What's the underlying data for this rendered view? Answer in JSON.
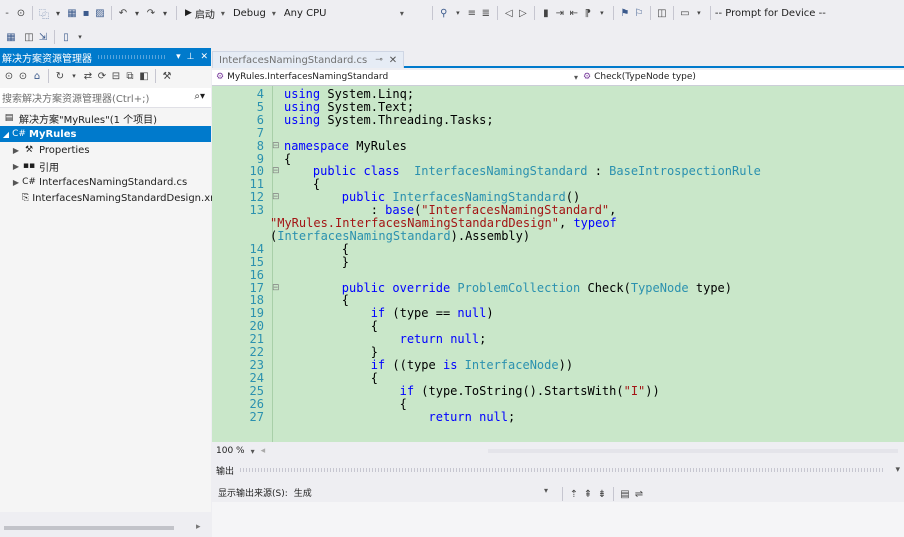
{
  "toolbar": {
    "start_label": "启动",
    "config_label": "Debug",
    "platform_label": "Any CPU",
    "prompt_label": "-- Prompt for Device --",
    "dropdown_glyph": "▾"
  },
  "solution_explorer": {
    "title": "解决方案资源管理器",
    "search_placeholder": "搜索解决方案资源管理器(Ctrl+;)",
    "items": [
      {
        "label": "解决方案\"MyRules\"(1 个项目)",
        "icon": "solution-icon"
      },
      {
        "label": "MyRules",
        "icon": "csharp-project-icon",
        "selected": true
      },
      {
        "label": "Properties",
        "icon": "wrench-icon"
      },
      {
        "label": "引用",
        "icon": "references-icon"
      },
      {
        "label": "InterfacesNamingStandard.cs",
        "icon": "csharp-file-icon"
      },
      {
        "label": "InterfacesNamingStandardDesign.xml",
        "icon": "xml-file-icon"
      }
    ]
  },
  "editor": {
    "tab_title": "InterfacesNamingStandard.cs",
    "nav_left": "MyRules.InterfacesNamingStandard",
    "nav_right": "Check(TypeNode type)",
    "zoom": "100 %"
  },
  "code_lines": [
    {
      "ln": "4",
      "text": "using System.Linq;"
    },
    {
      "ln": "5",
      "text": "using System.Text;"
    },
    {
      "ln": "6",
      "text": "using System.Threading.Tasks;"
    },
    {
      "ln": "7",
      "text": ""
    },
    {
      "ln": "8",
      "text": "namespace MyRules"
    },
    {
      "ln": "9",
      "text": "{"
    },
    {
      "ln": "10",
      "text": "    public class  InterfacesNamingStandard : BaseIntrospectionRule"
    },
    {
      "ln": "11",
      "text": "    {"
    },
    {
      "ln": "12",
      "text": "        public InterfacesNamingStandard()"
    },
    {
      "ln": "13",
      "text": "            : base(\"InterfacesNamingStandard\","
    },
    {
      "ln": "",
      "text": "\"MyRules.InterfacesNamingStandardDesign\", typeof"
    },
    {
      "ln": "",
      "text": "(InterfacesNamingStandard).Assembly)"
    },
    {
      "ln": "14",
      "text": "        {"
    },
    {
      "ln": "15",
      "text": "        }"
    },
    {
      "ln": "16",
      "text": ""
    },
    {
      "ln": "17",
      "text": "        public override ProblemCollection Check(TypeNode type)"
    },
    {
      "ln": "18",
      "text": "        {"
    },
    {
      "ln": "19",
      "text": "            if (type == null)"
    },
    {
      "ln": "20",
      "text": "            {"
    },
    {
      "ln": "21",
      "text": "                return null;"
    },
    {
      "ln": "22",
      "text": "            }"
    },
    {
      "ln": "23",
      "text": "            if ((type is InterfaceNode))"
    },
    {
      "ln": "24",
      "text": "            {"
    },
    {
      "ln": "25",
      "text": "                if (type.ToString().StartsWith(\"I\"))"
    },
    {
      "ln": "26",
      "text": "                {"
    },
    {
      "ln": "27",
      "text": "                    return null;"
    }
  ],
  "output": {
    "title": "输出",
    "source_label": "显示输出来源(S):",
    "source_value": "生成"
  },
  "colors": {
    "accent": "#007acc",
    "code_background": "#c9e7c9",
    "keyword": "#0000ff",
    "type": "#2b91af",
    "string": "#a31515"
  }
}
